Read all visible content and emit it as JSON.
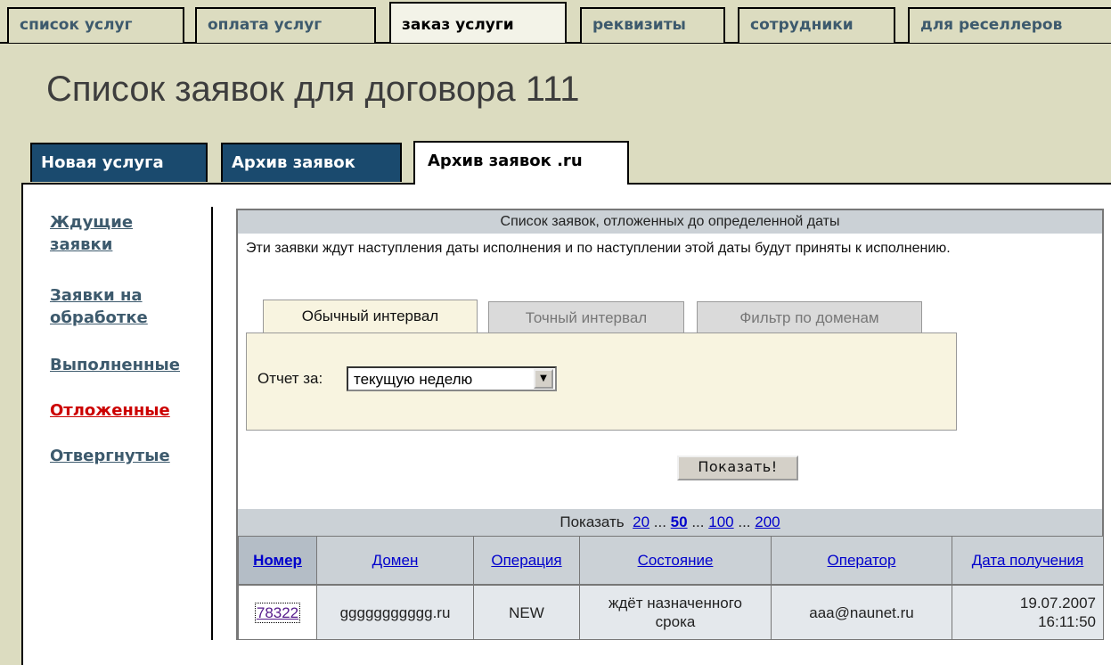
{
  "top_tabs": [
    {
      "label": "список услуг"
    },
    {
      "label": "оплата услуг"
    },
    {
      "label": "заказ услуги"
    },
    {
      "label": "реквизиты"
    },
    {
      "label": "сотрудники"
    },
    {
      "label": "для реселлеров"
    }
  ],
  "title": "Список заявок для договора 111",
  "sub_tabs": [
    {
      "label": "Новая услуга"
    },
    {
      "label": "Архив заявок"
    },
    {
      "label": "Архив заявок .ru"
    }
  ],
  "side_menu": [
    {
      "line1": "Ждущие",
      "line2": "заявки"
    },
    {
      "line1": "Заявки на",
      "line2": "обработке"
    },
    {
      "line1": "Выполненные"
    },
    {
      "line1": "Отложенные"
    },
    {
      "line1": "Отвергнутые"
    }
  ],
  "panel": {
    "heading": "Список заявок, отложенных до определенной даты",
    "description": "Эти заявки ждут наступления даты исполнения и по наступлении этой даты будут приняты к исполнению."
  },
  "filter_tabs": [
    {
      "label": "Обычный интервал"
    },
    {
      "label": "Точный интервал"
    },
    {
      "label": "Фильтр по доменам"
    }
  ],
  "report": {
    "label": "Отчет за:",
    "selected": "текущую неделю"
  },
  "show_button": "Показать!",
  "pager": {
    "label": "Показать",
    "options": [
      "20",
      "50",
      "100",
      "200"
    ],
    "separator": "..."
  },
  "table": {
    "headers": [
      "Номер",
      "Домен",
      "Операция",
      "Состояние",
      "Оператор",
      "Дата получения"
    ],
    "rows": [
      {
        "number": "78322",
        "domain": "ggggggggggg.ru",
        "operation": "NEW",
        "status": "ждёт назначенного срока",
        "operator": "aaa@naunet.ru",
        "date": "19.07.2007",
        "time": "16:11:50"
      }
    ]
  }
}
